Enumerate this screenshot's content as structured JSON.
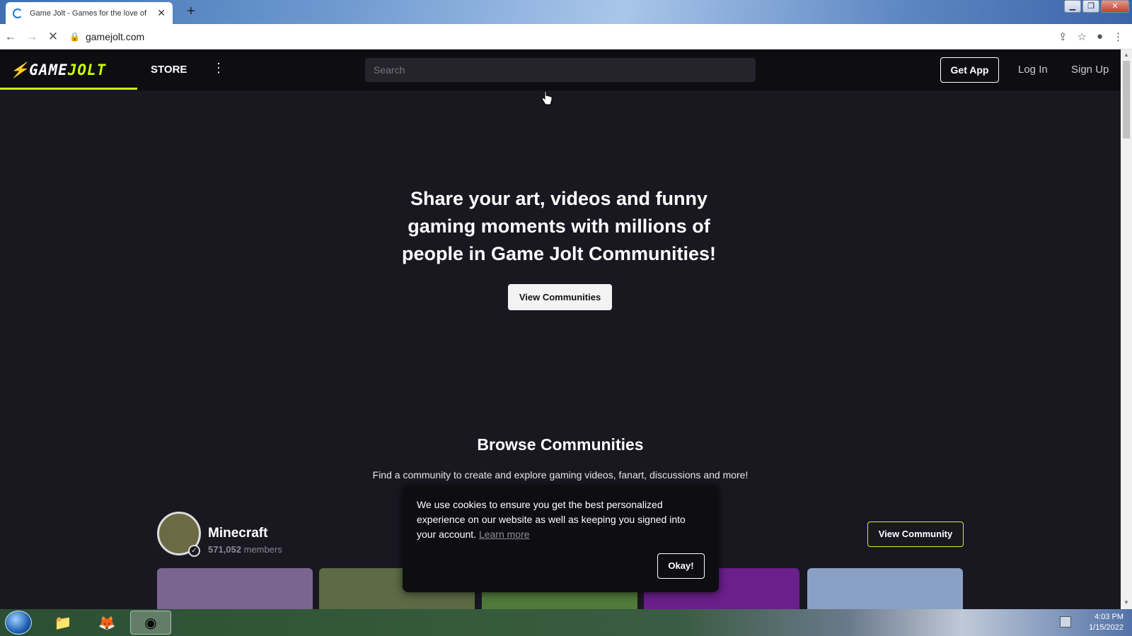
{
  "browser": {
    "tab_title": "Game Jolt - Games for the love of",
    "new_tab_label": "+",
    "url": "gamejolt.com",
    "window_controls": [
      "minimize",
      "restore",
      "close"
    ]
  },
  "header": {
    "logo_game": "GAME",
    "logo_jolt": "JOLT",
    "store_label": "STORE",
    "search_placeholder": "Search",
    "get_app_label": "Get App",
    "login_label": "Log In",
    "signup_label": "Sign Up"
  },
  "hero": {
    "title": "Share your art, videos and funny gaming moments with millions of people in Game Jolt Communities!",
    "button_label": "View Communities"
  },
  "browse": {
    "title": "Browse Communities",
    "subtitle": "Find a community to create and explore gaming videos, fanart, discussions and more!",
    "community": {
      "name": "Minecraft",
      "member_count": "571,052",
      "member_suffix": "members",
      "button_label": "View Community"
    },
    "card_colors": [
      "#7a6590",
      "#5d6a45",
      "#4f7a3a",
      "#6a1f8a",
      "#8aa0c4"
    ]
  },
  "cookie": {
    "text": "We use cookies to ensure you get the best personalized experience on our website as well as keeping you signed into your account.",
    "link_label": "Learn more",
    "button_label": "Okay!"
  },
  "taskbar": {
    "time": "4:03 PM",
    "date": "1/15/2022"
  },
  "colors": {
    "accent": "#ccff00",
    "background": "#191720",
    "header_bg": "#0e0d12"
  }
}
